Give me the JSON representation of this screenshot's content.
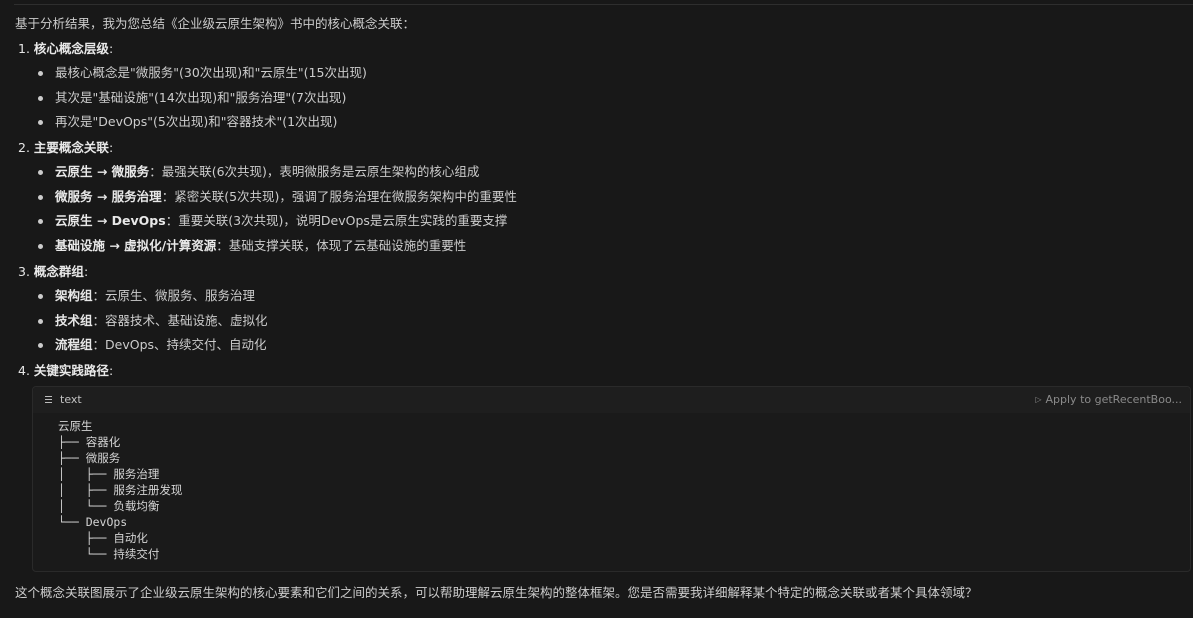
{
  "intro": "基于分析结果，我为您总结《企业级云原生架构》书中的核心概念关联：",
  "sections": [
    {
      "number": "1.",
      "title": "核心概念层级",
      "items": [
        {
          "bold": "",
          "text": "最核心概念是\"微服务\"(30次出现)和\"云原生\"(15次出现)"
        },
        {
          "bold": "",
          "text": "其次是\"基础设施\"(14次出现)和\"服务治理\"(7次出现)"
        },
        {
          "bold": "",
          "text": "再次是\"DevOps\"(5次出现)和\"容器技术\"(1次出现)"
        }
      ]
    },
    {
      "number": "2.",
      "title": "主要概念关联",
      "items": [
        {
          "bold": "云原生 → 微服务",
          "text": "：最强关联(6次共现)，表明微服务是云原生架构的核心组成"
        },
        {
          "bold": "微服务 → 服务治理",
          "text": "：紧密关联(5次共现)，强调了服务治理在微服务架构中的重要性"
        },
        {
          "bold": "云原生 → DevOps",
          "text": "：重要关联(3次共现)，说明DevOps是云原生实践的重要支撑"
        },
        {
          "bold": "基础设施 → 虚拟化/计算资源",
          "text": "：基础支撑关联，体现了云基础设施的重要性"
        }
      ]
    },
    {
      "number": "3.",
      "title": "概念群组",
      "items": [
        {
          "bold": "架构组",
          "text": "：云原生、微服务、服务治理"
        },
        {
          "bold": "技术组",
          "text": "：容器技术、基础设施、虚拟化"
        },
        {
          "bold": "流程组",
          "text": "：DevOps、持续交付、自动化"
        }
      ]
    },
    {
      "number": "4.",
      "title": "关键实践路径",
      "items": []
    }
  ],
  "code_block": {
    "language": "text",
    "apply_label": "Apply to getRecentBoo...",
    "icon": "list-lines-icon",
    "lines": [
      "云原生",
      "├── 容器化",
      "├── 微服务",
      "│   ├── 服务治理",
      "│   ├── 服务注册发现",
      "│   └── 负载均衡",
      "└── DevOps",
      "    ├── 自动化",
      "    └── 持续交付"
    ]
  },
  "outro": "这个概念关联图展示了企业级云原生架构的核心要素和它们之间的关系，可以帮助理解云原生架构的整体框架。您是否需要我详细解释某个特定的概念关联或者某个具体领域？"
}
